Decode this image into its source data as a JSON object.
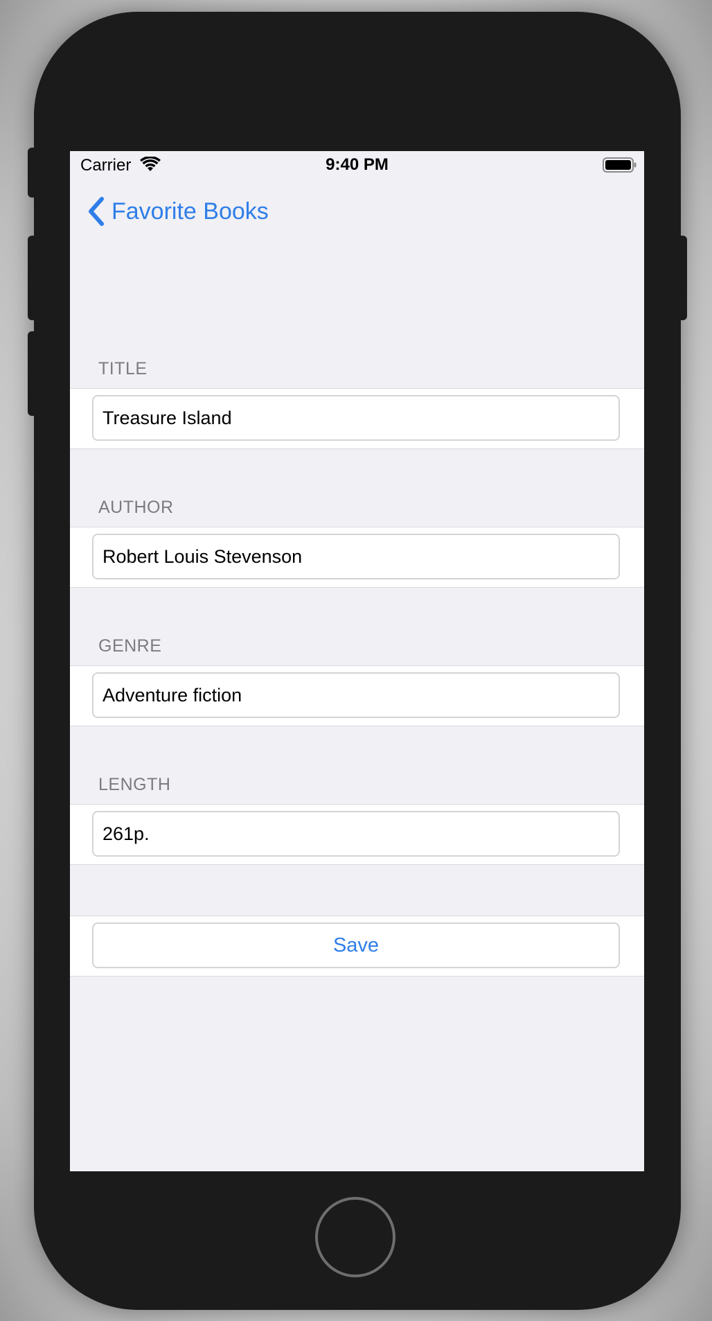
{
  "status_bar": {
    "carrier": "Carrier",
    "time": "9:40 PM",
    "wifi_icon": "wifi-icon",
    "battery_icon": "battery-icon"
  },
  "nav": {
    "back_label": "Favorite Books",
    "back_icon": "chevron-left-icon"
  },
  "form": {
    "title": {
      "header": "TITLE",
      "value": "Treasure Island"
    },
    "author": {
      "header": "AUTHOR",
      "value": "Robert Louis Stevenson"
    },
    "genre": {
      "header": "GENRE",
      "value": "Adventure fiction"
    },
    "length": {
      "header": "LENGTH",
      "value": "261p."
    },
    "save_label": "Save"
  },
  "colors": {
    "accent": "#2f7ee8",
    "background": "#f0f0f5",
    "header_text": "#7b7b80"
  }
}
